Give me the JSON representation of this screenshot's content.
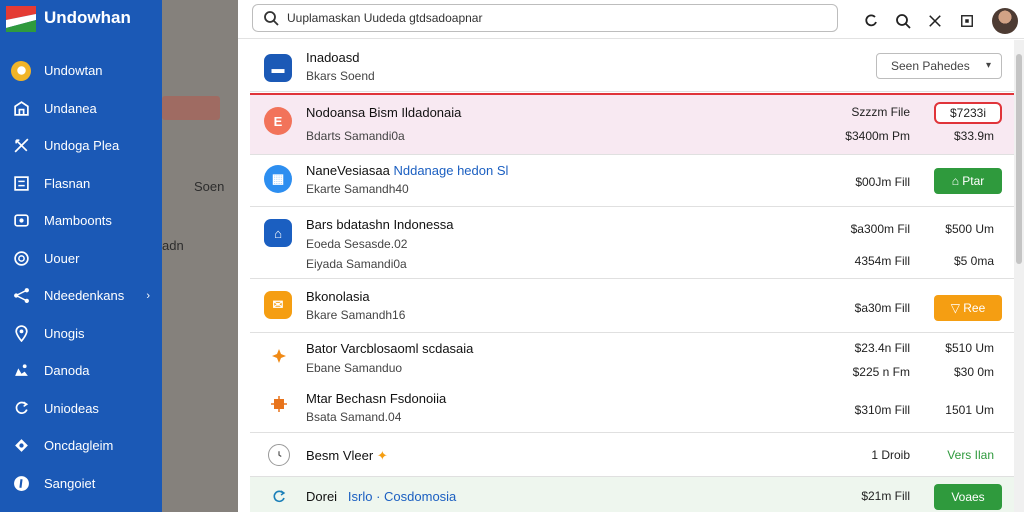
{
  "app": {
    "title": "Undowhan"
  },
  "sidebar": {
    "items": [
      {
        "label": "Undowtan",
        "icon": "home-icon",
        "active": true
      },
      {
        "label": "Undanea",
        "icon": "store-icon"
      },
      {
        "label": "Undoga Plea",
        "icon": "tools-icon"
      },
      {
        "label": "Flasnan",
        "icon": "list-icon"
      },
      {
        "label": "Mamboonts",
        "icon": "settings-icon"
      },
      {
        "label": "Uouer",
        "icon": "user-icon"
      },
      {
        "label": "Ndeedenkans",
        "icon": "share-icon",
        "chevron": "›"
      },
      {
        "label": "Unogis",
        "icon": "location-icon"
      },
      {
        "label": "Danoda",
        "icon": "alert-icon"
      },
      {
        "label": "Uniodeas",
        "icon": "sync-icon"
      },
      {
        "label": "Oncdagleim",
        "icon": "shield-icon"
      },
      {
        "label": "Sangoiet",
        "icon": "info-icon"
      }
    ]
  },
  "background": {
    "text1": "Soen",
    "text2": "adn"
  },
  "search": {
    "value": "Uuplamaskan Uudeda gtdsadoapnar"
  },
  "list": {
    "header": {
      "title": "Inadoasd",
      "subtitle": "Bkars Soend",
      "select_label": "Seen Pahedes",
      "select_caret": "▾"
    },
    "rows": [
      {
        "title": "Nodoansa Bism Ildadonaia",
        "sub": "Bdarts Samandi0a",
        "mid1": "Szzzm File",
        "mid2": "$3400m Pm",
        "tag": "$7233i",
        "right2": "$33.9m",
        "icon_color": "#f2735a",
        "icon_glyph": "E"
      },
      {
        "title": "NaneVesiasaa",
        "title_link": "Nddanage hedon Sl",
        "sub": "Ekarte Samandh40",
        "mid1": "$00Jm Fill",
        "btn": "⌂ Ptar",
        "icon_color": "#2d8ef0",
        "icon_glyph": "▦"
      },
      {
        "title": "Bars bdatashn Indonessa",
        "sub": "Eoeda Sesasde.02",
        "sub2": "Eiyada Samandi0a",
        "mid1": "$a300m Fil",
        "mid2": "4354m Fill",
        "right1": "$500 Um",
        "right2": "$5 0ma",
        "icon_color": "#1b5fc1",
        "icon_glyph": "⌂"
      },
      {
        "title": "Bkonolasia",
        "sub": "Bkare Samandh16",
        "mid1": "$a30m Fill",
        "btn": "▽ Ree",
        "icon_color": "#f59e12",
        "icon_glyph": "✉"
      },
      {
        "title": "Bator Varcblosaoml scdasaia",
        "sub": "Ebane Samanduo",
        "mid1": "$23.4n Fill",
        "mid2": "$225 n Fm",
        "right1": "$510 Um",
        "right2": "$30 0m"
      },
      {
        "title": "Mtar Bechasn Fsdonoiia",
        "sub": "Bsata Samand.04",
        "mid1": "$310m Fill",
        "right1": "1501 Um"
      },
      {
        "title": "Besm Vleer",
        "mid1": "1 Droib",
        "right1": "Vers Ilan"
      },
      {
        "title": "Dorei",
        "title_link": "Isrlo · Cosdomosia",
        "mid1": "$21m Fill",
        "btn": "Voaes"
      }
    ]
  },
  "colors": {
    "sidebar": "#1b59b6",
    "accent_green": "#2f9a3d",
    "accent_orange": "#f59e12",
    "highlight": "#f8e9f2",
    "alert_red": "#e0343a"
  }
}
